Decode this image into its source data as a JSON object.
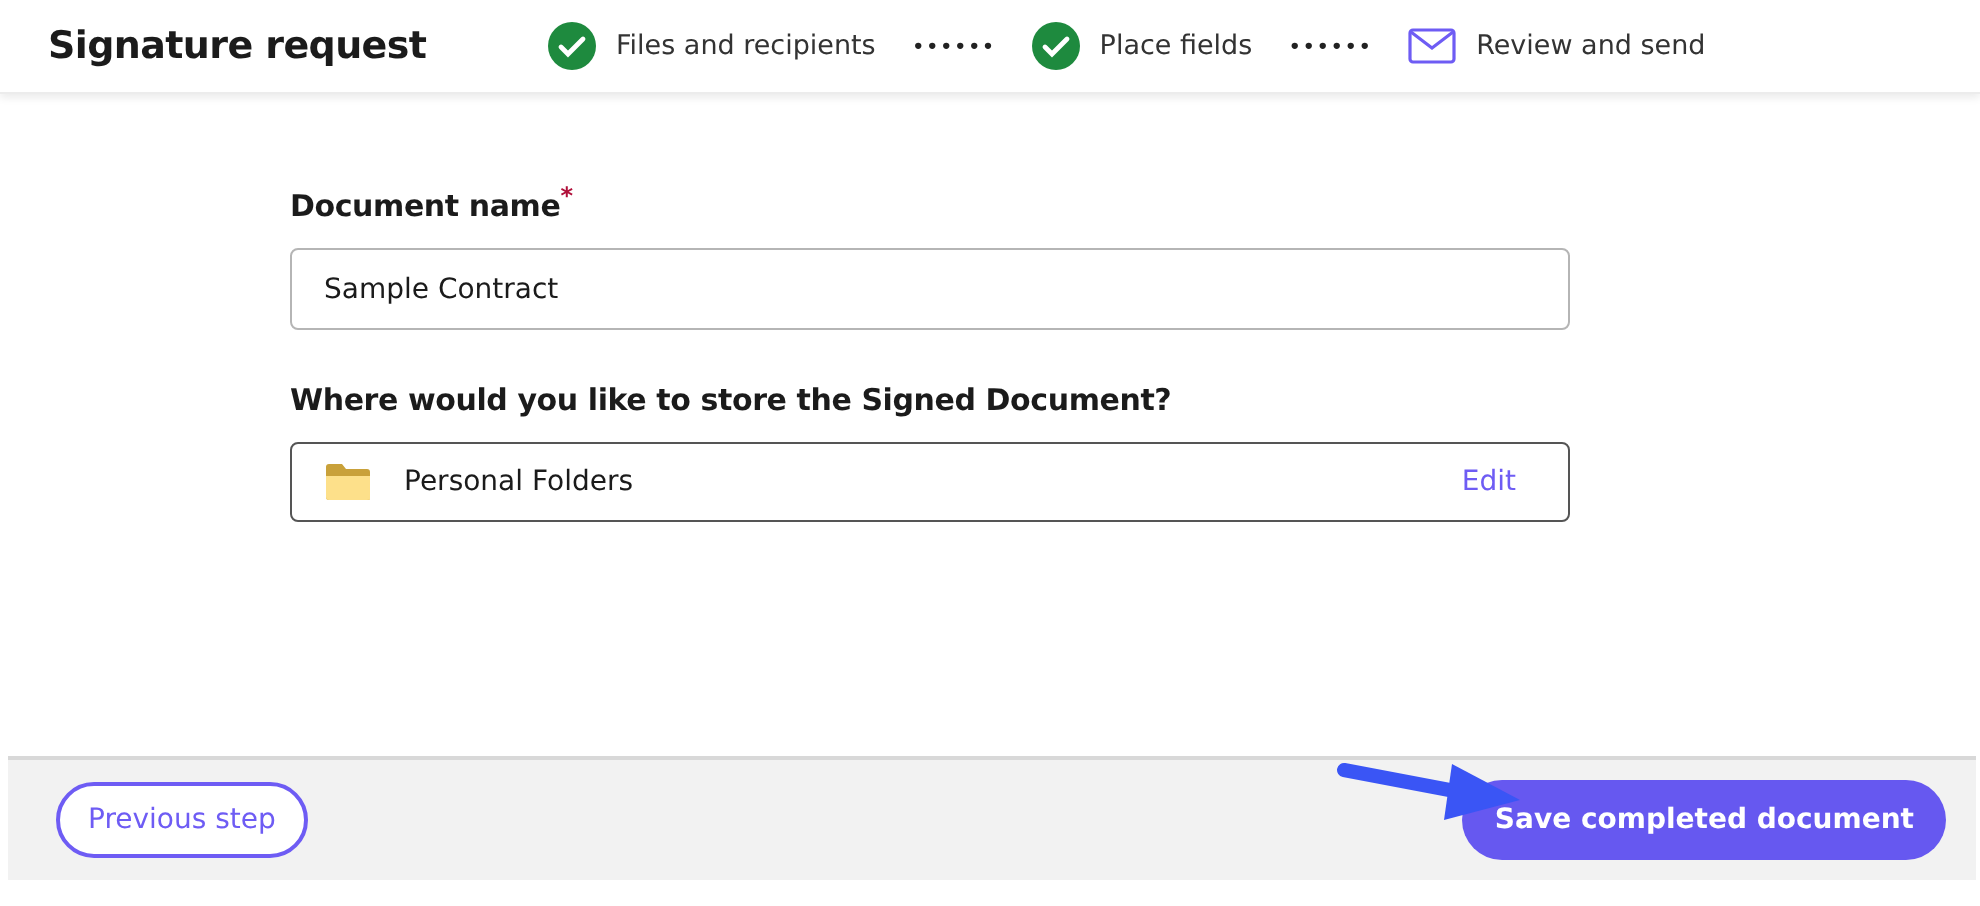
{
  "header": {
    "title": "Signature request"
  },
  "steps": [
    {
      "label": "Files and recipients",
      "completed": true
    },
    {
      "label": "Place fields",
      "completed": true
    },
    {
      "label": "Review and send",
      "completed": false
    }
  ],
  "step_separator": "••••••",
  "document_name": {
    "label": "Document name",
    "required_mark": "*",
    "value": "Sample Contract"
  },
  "storage": {
    "label": "Where would you like to store the Signed Document?",
    "folder": "Personal Folders",
    "action": "Edit"
  },
  "footer": {
    "back_button": "Previous step",
    "primary_button": "Save completed document"
  }
}
